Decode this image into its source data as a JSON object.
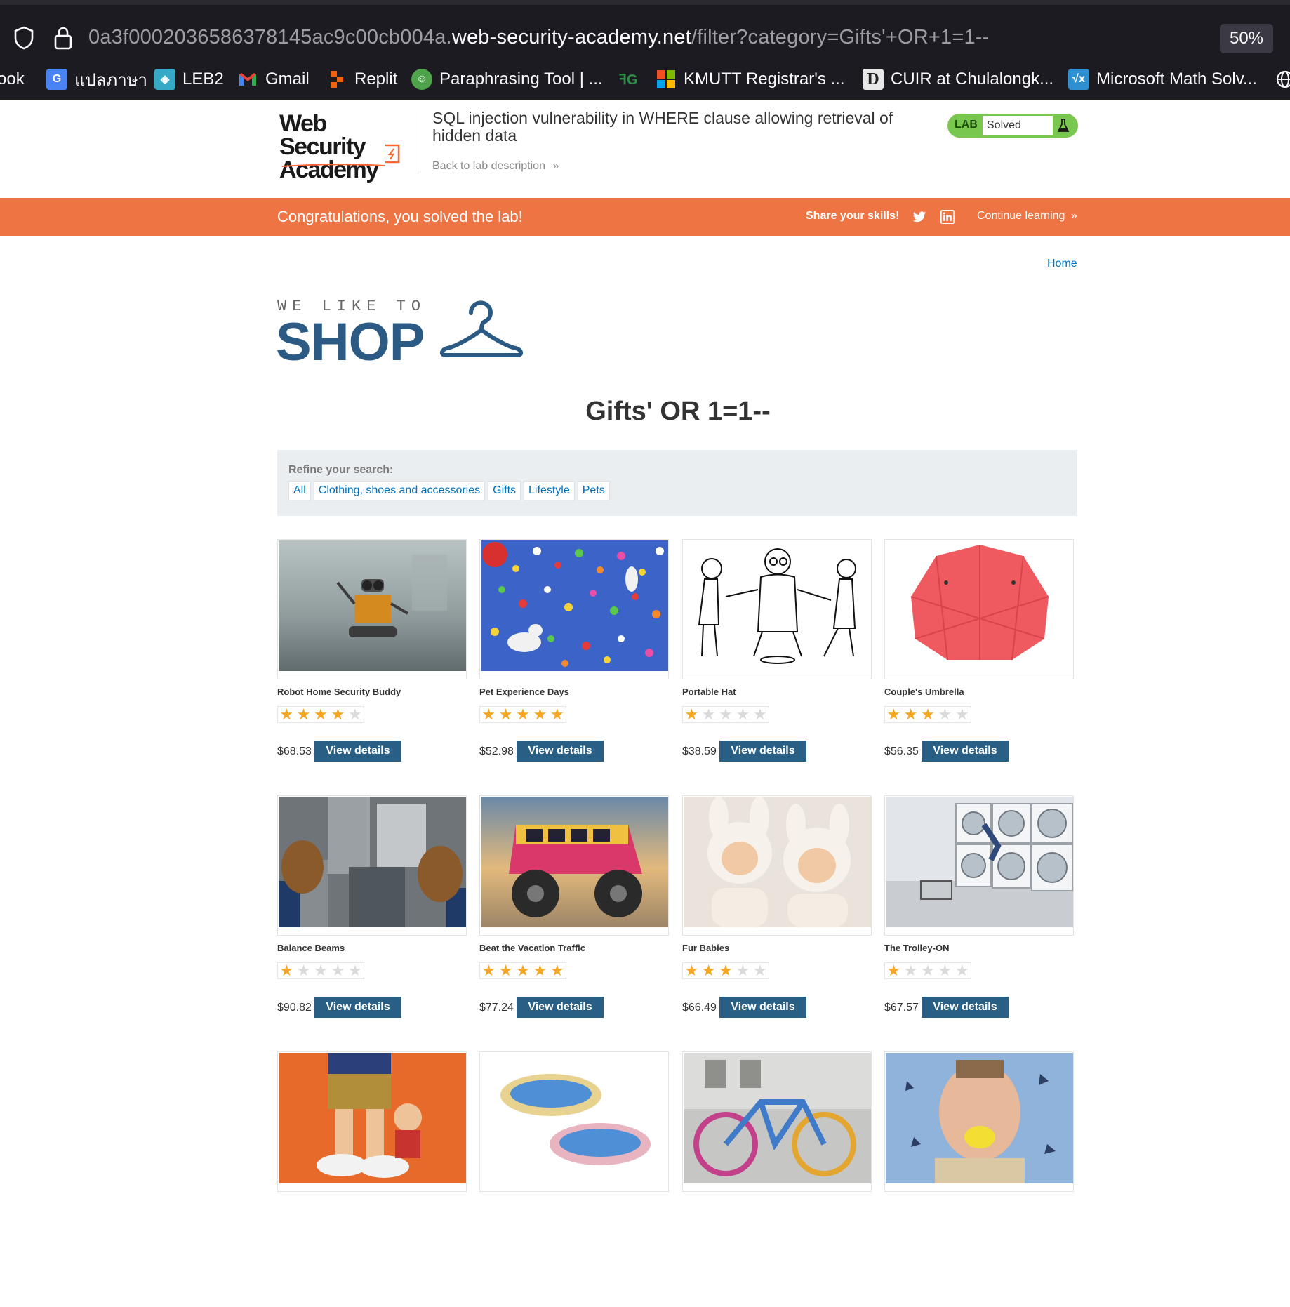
{
  "browser": {
    "url_prefix": "0a3f0002036586378145ac9c00cb004a.",
    "url_host": "web-security-academy.net",
    "url_path": "/filter?category=Gifts'+OR+1=1--",
    "zoom": "50%",
    "bookmarks": [
      {
        "label": "ook",
        "icon": "facebook-icon",
        "color": ""
      },
      {
        "label": "แปลภาษา",
        "icon": "google-translate-icon",
        "color": "#4a83f3"
      },
      {
        "label": "LEB2",
        "icon": "leb2-icon",
        "color": "#36a9c7"
      },
      {
        "label": "Gmail",
        "icon": "gmail-icon",
        "color": ""
      },
      {
        "label": "Replit",
        "icon": "replit-icon",
        "color": "#f26207"
      },
      {
        "label": "Paraphrasing Tool | ...",
        "icon": "quillbot-icon",
        "color": "#4ea34b"
      },
      {
        "label": "",
        "icon": "geeksforgeeks-icon",
        "color": "#2f8d46"
      },
      {
        "label": "KMUTT Registrar's ...",
        "icon": "microsoft-icon",
        "color": ""
      },
      {
        "label": "CUIR at Chulalongk...",
        "icon": "dspace-icon",
        "color": "#e8e8e8"
      },
      {
        "label": "Microsoft Math Solv...",
        "icon": "math-solver-icon",
        "color": "#2e8fd1"
      },
      {
        "label": "",
        "icon": "globe-icon",
        "color": ""
      }
    ]
  },
  "lab": {
    "logo_line1": "Web Security",
    "logo_line2": "Academy",
    "title": "SQL injection vulnerability in WHERE clause allowing retrieval of hidden data",
    "back_link": "Back to lab description",
    "status_tag": "LAB",
    "status": "Solved"
  },
  "banner": {
    "message": "Congratulations, you solved the lab!",
    "share": "Share your skills!",
    "continue": "Continue learning"
  },
  "shop": {
    "home": "Home",
    "tagline": "WE LIKE TO",
    "logo_word": "SHOP",
    "category_title": "Gifts' OR 1=1--",
    "refine_label": "Refine your search:",
    "filters": [
      "All",
      "Clothing, shoes and accessories",
      "Gifts",
      "Lifestyle",
      "Pets"
    ],
    "view_label": "View details"
  },
  "products": [
    {
      "name": "Robot Home Security Buddy",
      "rating": 4,
      "price": "$68.53",
      "image": "robot-image"
    },
    {
      "name": "Pet Experience Days",
      "rating": 5,
      "price": "$52.98",
      "image": "balloons-dog-image"
    },
    {
      "name": "Portable Hat",
      "rating": 1,
      "price": "$38.59",
      "image": "sketch-image"
    },
    {
      "name": "Couple's Umbrella",
      "rating": 3,
      "price": "$56.35",
      "image": "umbrella-image"
    },
    {
      "name": "Balance Beams",
      "rating": 1,
      "price": "$90.82",
      "image": "city-shoes-image"
    },
    {
      "name": "Beat the Vacation Traffic",
      "rating": 5,
      "price": "$77.24",
      "image": "monster-van-image"
    },
    {
      "name": "Fur Babies",
      "rating": 3,
      "price": "$66.49",
      "image": "babies-image"
    },
    {
      "name": "The Trolley-ON",
      "rating": 1,
      "price": "$67.57",
      "image": "laundromat-image"
    },
    {
      "name": "",
      "rating": 0,
      "price": "",
      "image": "figurine-image"
    },
    {
      "name": "",
      "rating": 0,
      "price": "",
      "image": "paddling-pool-image"
    },
    {
      "name": "",
      "rating": 0,
      "price": "",
      "image": "knitted-bike-image"
    },
    {
      "name": "",
      "rating": 0,
      "price": "",
      "image": "lemon-man-image"
    }
  ],
  "colors": {
    "banner": "#ee7444",
    "button": "#295f85",
    "link": "#0071bc",
    "lab_green": "#7ac74f",
    "star": "#f5a623"
  }
}
